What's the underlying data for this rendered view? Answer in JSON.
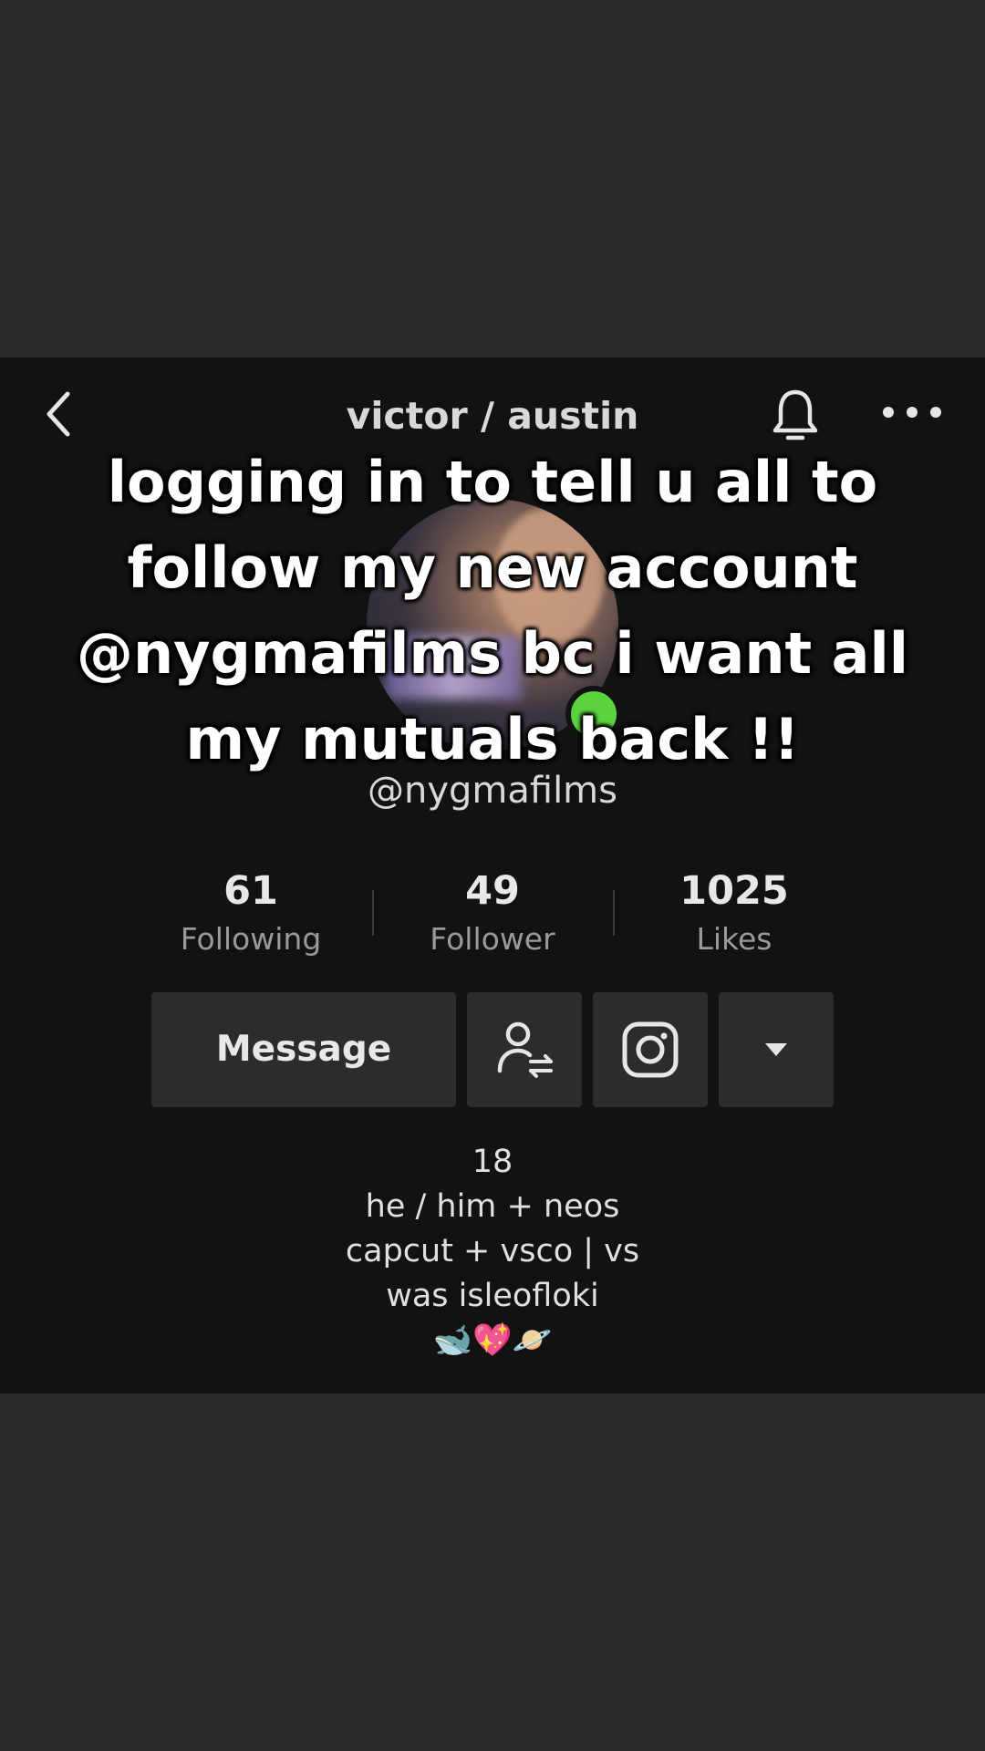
{
  "header": {
    "back_icon": "chevron-left-icon",
    "title": "victor / austin",
    "bell_icon": "bell-icon",
    "more_icon": "more-horizontal-icon"
  },
  "overlay_text": "logging in to tell u all to follow my new account @nygmafilms bc i want all my mutuals back !!",
  "profile": {
    "handle": "@nygmafilms",
    "online_status_color": "#5ad33e"
  },
  "stats": [
    {
      "value": "61",
      "label": "Following"
    },
    {
      "value": "49",
      "label": "Follower"
    },
    {
      "value": "1025",
      "label": "Likes"
    }
  ],
  "actions": {
    "message_label": "Message",
    "friend_icon": "user-swap-icon",
    "instagram_icon": "instagram-icon",
    "dropdown_icon": "caret-down-icon"
  },
  "bio": {
    "line1": "18",
    "line2": "he / him + neos",
    "line3": "capcut + vsco | vs",
    "line4": "was isleofloki",
    "line5": "🐋💖🪐"
  }
}
